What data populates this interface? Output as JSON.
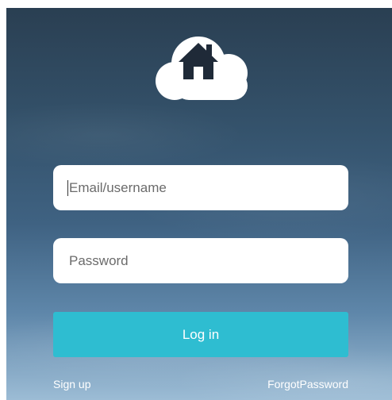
{
  "logo": {
    "icon": "cloud-home-icon",
    "colors": {
      "cloud": "#ffffff",
      "house": "#1f2a38"
    }
  },
  "form": {
    "email_placeholder": "Email/username",
    "password_placeholder": "Password",
    "login_label": "Log in"
  },
  "links": {
    "signup": "Sign up",
    "forgot": "ForgotPassword"
  },
  "colors": {
    "accent": "#2ebdd1",
    "background_top": "#2a3f52",
    "background_bottom": "#9cbcd5"
  }
}
